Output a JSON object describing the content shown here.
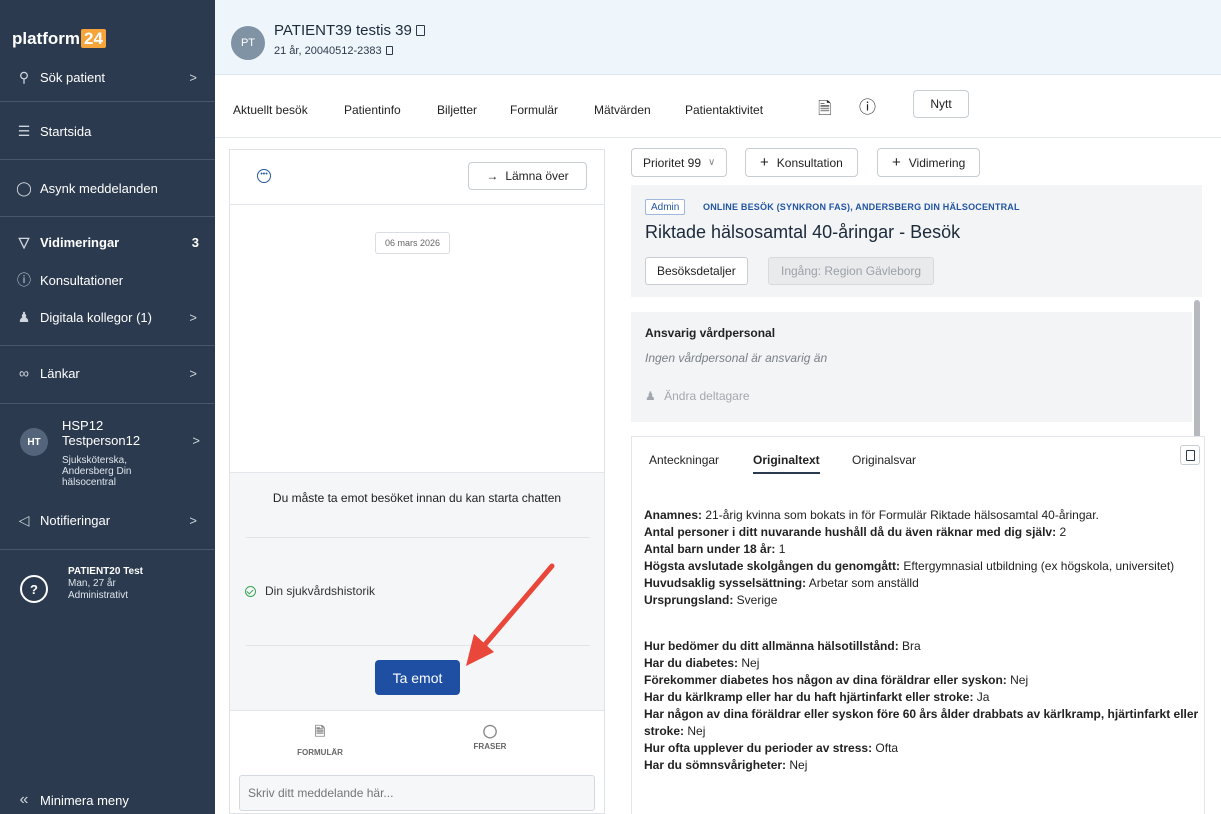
{
  "sidebar": {
    "logo_text": "platform",
    "logo_number": "24",
    "items": [
      {
        "label": "Sök patient"
      },
      {
        "label": "Startsida"
      },
      {
        "label": "Asynk meddelanden"
      },
      {
        "label": "Vidimeringar",
        "count": "3"
      },
      {
        "label": "Konsultationer"
      },
      {
        "label": "Digitala kollegor (1)"
      },
      {
        "label": "Länkar"
      },
      {
        "label": "Notifieringar"
      }
    ],
    "user": {
      "initials": "HT",
      "name_line1": "HSP12",
      "name_line2": "Testperson12",
      "role_line1": "Sjuksköterska,",
      "role_line2": "Andersberg Din",
      "role_line3": "hälsocentral"
    },
    "active_patient": {
      "name": "PATIENT20 Test",
      "line1": "Man, 27 år",
      "line2": "Administrativt"
    },
    "minimize_label": "Minimera meny"
  },
  "header": {
    "avatar_initials": "PT",
    "patient_name": "PATIENT39 testis 39",
    "patient_meta": "21 år, 20040512-2383"
  },
  "tabs": {
    "items": [
      "Aktuellt besök",
      "Patientinfo",
      "Biljetter",
      "Formulär",
      "Mätvärden",
      "Patientaktivitet"
    ],
    "new_button": "Nytt"
  },
  "chat": {
    "hand_over_button": "Lämna över",
    "date_label": "06 mars 2026",
    "info_text": "Du måste ta emot besöket innan du kan starta chatten",
    "history_label": "Din sjukvårdshistorik",
    "accept_button": "Ta emot",
    "tool_forms": "FORMULÄR",
    "tool_phrases": "FRASER",
    "input_placeholder": "Skriv ditt meddelande här..."
  },
  "actions": {
    "priority": "Prioritet 99",
    "consultation": "Konsultation",
    "vidimation": "Vidimering"
  },
  "visit": {
    "badge": "Admin",
    "type": "ONLINE BESÖK (SYNKRON FAS), ANDERSBERG DIN HÄLSOCENTRAL",
    "title": "Riktade hälsosamtal 40-åringar - Besök",
    "details_button": "Besöksdetaljer",
    "entry_button": "Ingång: Region Gävleborg"
  },
  "responsible": {
    "title": "Ansvarig vårdpersonal",
    "subtitle": "Ingen vårdpersonal är ansvarig än",
    "edit_label": "Ändra deltagare"
  },
  "notes": {
    "tabs": [
      "Anteckningar",
      "Originaltext",
      "Originalsvar"
    ],
    "active_tab": "Originaltext",
    "group1": [
      {
        "q": "Anamnes:",
        "a": " 21-årig kvinna som bokats in för Formulär Riktade hälsosamtal 40-åringar."
      },
      {
        "q": "Antal personer i ditt nuvarande hushåll då du även räknar med dig själv:",
        "a": " 2"
      },
      {
        "q": "Antal barn under 18 år:",
        "a": " 1"
      },
      {
        "q": "Högsta avslutade skolgången du genomgått:",
        "a": " Eftergymnasial utbildning (ex högskola, universitet)"
      },
      {
        "q": "Huvudsaklig sysselsättning:",
        "a": " Arbetar som anställd"
      },
      {
        "q": "Ursprungsland:",
        "a": " Sverige"
      }
    ],
    "group2": [
      {
        "q": "Hur bedömer du ditt allmänna hälsotillstånd:",
        "a": " Bra"
      },
      {
        "q": "Har du diabetes:",
        "a": " Nej"
      },
      {
        "q": "Förekommer diabetes hos någon av dina föräldrar eller syskon:",
        "a": " Nej"
      },
      {
        "q": "Har du kärlkramp eller har du haft hjärtinfarkt eller stroke:",
        "a": " Ja"
      },
      {
        "q": "Har någon av dina föräldrar eller syskon före 60 års ålder drabbats av kärlkramp, hjärtinfarkt eller stroke:",
        "a": " Nej"
      },
      {
        "q": "Hur ofta upplever du perioder av stress:",
        "a": " Ofta"
      },
      {
        "q": "Har du sömnsvårigheter:",
        "a": " Nej"
      }
    ]
  },
  "colors": {
    "sidebar_bg": "#2b3a4e",
    "primary": "#1e4fa3",
    "logo_accent": "#f7a43a",
    "arrow": "#e8473a"
  }
}
